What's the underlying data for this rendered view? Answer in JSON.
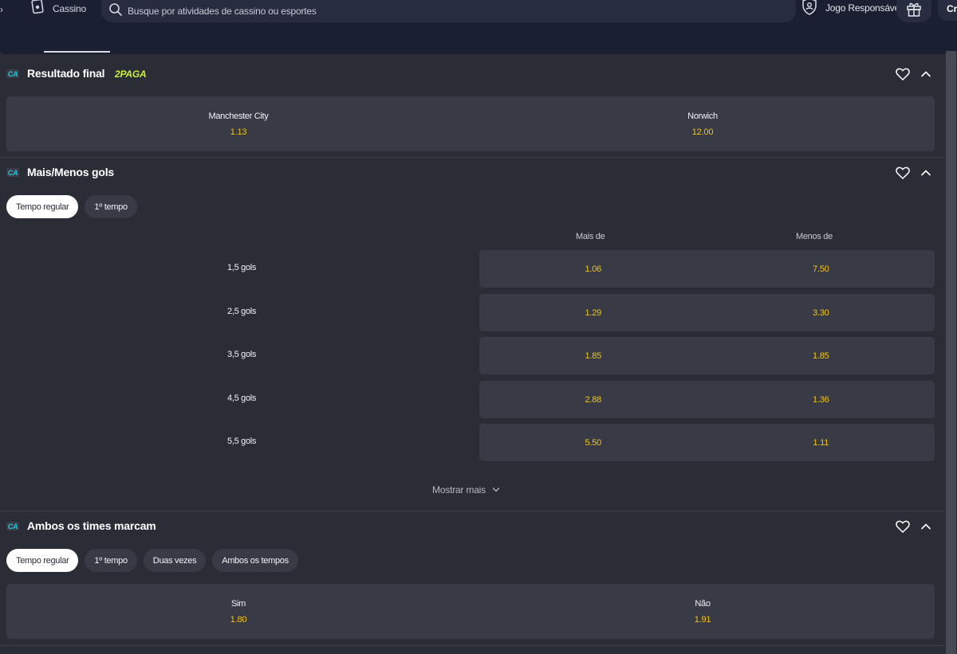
{
  "header": {
    "edge_glyph": "›",
    "casino_label": "Cassino",
    "search_placeholder": "Busque por atividades de cassino ou esportes",
    "responsible_label": "Jogo Responsável",
    "cut_label": "Cri"
  },
  "icons": {
    "casino": "casino-cards-icon",
    "search": "search-icon",
    "responsible": "shield-user-icon",
    "gift": "gift-icon",
    "favorite": "heart-icon",
    "collapse": "chevron-up-icon",
    "show_more": "chevron-down-icon"
  },
  "colors": {
    "background": "#2b2d36",
    "header_bg": "#1b1f32",
    "box_bg": "#383b46",
    "odds": "#f3c316",
    "badge_text": "#27c3d6",
    "promo": "#c6f13b"
  },
  "markets": {
    "result": {
      "badge": "CA",
      "title": "Resultado final",
      "promo": "2PAGA",
      "outcomes": [
        {
          "name": "Manchester City",
          "price": "1.13"
        },
        {
          "name": "Norwich",
          "price": "12.00"
        }
      ]
    },
    "goals": {
      "badge": "CA",
      "title": "Mais/Menos gols",
      "tabs": [
        "Tempo regular",
        "1º tempo"
      ],
      "active_tab": 0,
      "col_over": "Mais de",
      "col_under": "Menos de",
      "rows": [
        {
          "label": "1,5 gols",
          "over": "1.06",
          "under": "7.50"
        },
        {
          "label": "2,5 gols",
          "over": "1.29",
          "under": "3.30"
        },
        {
          "label": "3,5 gols",
          "over": "1.85",
          "under": "1.85"
        },
        {
          "label": "4,5 gols",
          "over": "2.88",
          "under": "1.36"
        },
        {
          "label": "5,5 gols",
          "over": "5.50",
          "under": "1.11"
        }
      ],
      "show_more": "Mostrar mais"
    },
    "btts": {
      "badge": "CA",
      "title": "Ambos os times marcam",
      "tabs": [
        "Tempo regular",
        "1º tempo",
        "Duas vezes",
        "Ambos os tempos"
      ],
      "active_tab": 0,
      "outcomes": [
        {
          "name": "Sim",
          "price": "1.80"
        },
        {
          "name": "Não",
          "price": "1.91"
        }
      ]
    }
  }
}
